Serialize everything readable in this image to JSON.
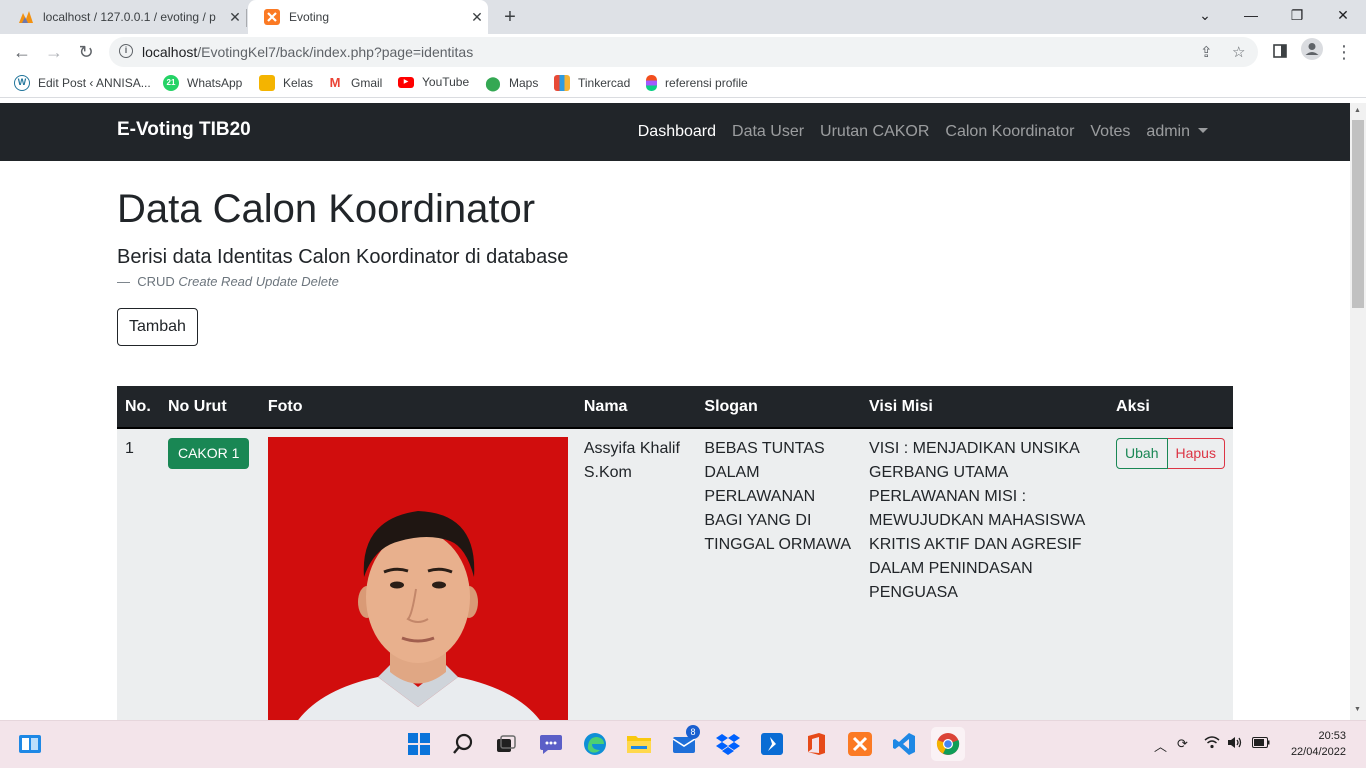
{
  "browser": {
    "tabs": [
      {
        "title": "localhost / 127.0.0.1 / evoting / p",
        "active": false
      },
      {
        "title": "Evoting",
        "active": true
      }
    ],
    "url_host": "localhost",
    "url_path": "/EvotingKel7/back/index.php?page=identitas",
    "bookmarks": [
      {
        "label": "Edit Post ‹ ANNISA...",
        "icon": "wordpress-icon"
      },
      {
        "label": "WhatsApp",
        "icon": "whatsapp-icon",
        "badge": "21"
      },
      {
        "label": "Kelas",
        "icon": "classroom-icon"
      },
      {
        "label": "Gmail",
        "icon": "gmail-icon"
      },
      {
        "label": "YouTube",
        "icon": "youtube-icon"
      },
      {
        "label": "Maps",
        "icon": "maps-icon"
      },
      {
        "label": "Tinkercad",
        "icon": "tinkercad-icon"
      },
      {
        "label": "referensi profile",
        "icon": "figma-icon"
      }
    ]
  },
  "site": {
    "brand": "E-Voting TIB20",
    "nav": [
      {
        "label": "Dashboard",
        "active": true
      },
      {
        "label": "Data User",
        "active": false
      },
      {
        "label": "Urutan CAKOR",
        "active": false
      },
      {
        "label": "Calon Koordinator",
        "active": false
      },
      {
        "label": "Votes",
        "active": false
      },
      {
        "label": "admin",
        "active": false,
        "dropdown": true
      }
    ]
  },
  "page": {
    "title": "Data Calon Koordinator",
    "lead": "Berisi data Identitas Calon Koordinator di database",
    "note_prefix": "CRUD",
    "note_italic": "Create Read Update Delete",
    "add_button": "Tambah"
  },
  "table": {
    "headers": [
      "No.",
      "No Urut",
      "Foto",
      "Nama",
      "Slogan",
      "Visi Misi",
      "Aksi"
    ],
    "rows": [
      {
        "no": "1",
        "no_urut": "CAKOR 1",
        "nama": "Assyifa Khalif S.Kom",
        "slogan": "BEBAS TUNTAS DALAM PERLAWANAN BAGI YANG DI TINGGAL ORMAWA",
        "visi_misi": "VISI : MENJADIKAN UNSIKA GERBANG UTAMA PERLAWANAN MISI : MEWUJUDKAN MAHASISWA KRITIS AKTIF DAN AGRESIF DALAM PENINDASAN PENGUASA",
        "edit_label": "Ubah",
        "delete_label": "Hapus"
      }
    ]
  },
  "colors": {
    "navbar": "#212529",
    "success": "#198754",
    "danger": "#dc3545",
    "photo_bg": "#d10d0d"
  },
  "taskbar": {
    "mail_badge": "8",
    "time": "20:53",
    "date": "22/04/2022"
  }
}
